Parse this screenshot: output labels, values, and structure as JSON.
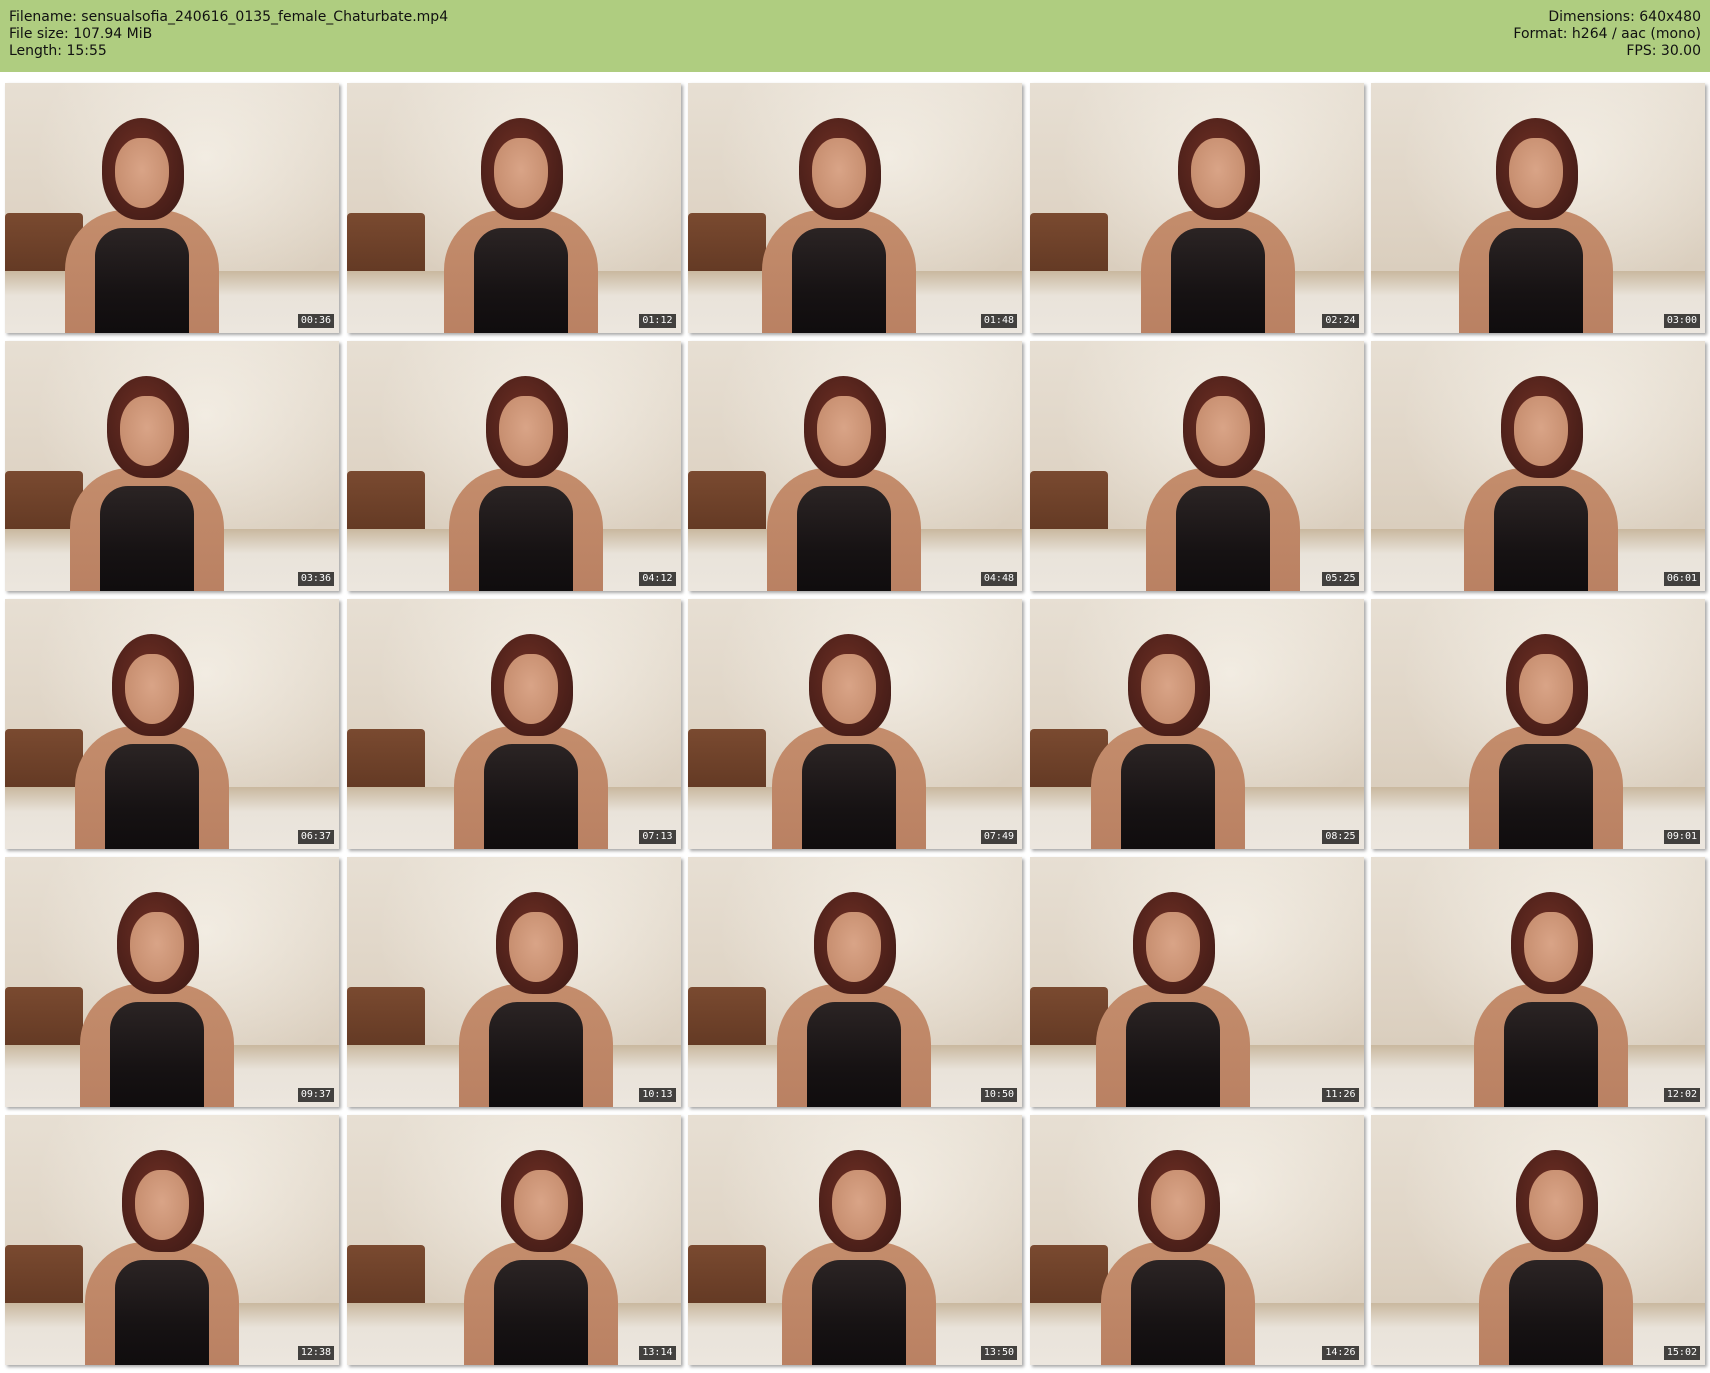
{
  "header": {
    "filename_line": "Filename: sensualsofia_240616_0135_female_Chaturbate.mp4",
    "filesize_line": "File size: 107.94 MiB",
    "length_line": "Length: 15:55",
    "dimensions_line": "Dimensions: 640x480",
    "format_line": "Format: h264 / aac (mono)",
    "fps_line": "FPS: 30.00",
    "background_color": "#afcd80"
  },
  "thumbnails": [
    {
      "timestamp": "00:36"
    },
    {
      "timestamp": "01:12"
    },
    {
      "timestamp": "01:48"
    },
    {
      "timestamp": "02:24"
    },
    {
      "timestamp": "03:00"
    },
    {
      "timestamp": "03:36"
    },
    {
      "timestamp": "04:12"
    },
    {
      "timestamp": "04:48"
    },
    {
      "timestamp": "05:25"
    },
    {
      "timestamp": "06:01"
    },
    {
      "timestamp": "06:37"
    },
    {
      "timestamp": "07:13"
    },
    {
      "timestamp": "07:49"
    },
    {
      "timestamp": "08:25"
    },
    {
      "timestamp": "09:01"
    },
    {
      "timestamp": "09:37"
    },
    {
      "timestamp": "10:13"
    },
    {
      "timestamp": "10:50"
    },
    {
      "timestamp": "11:26"
    },
    {
      "timestamp": "12:02"
    },
    {
      "timestamp": "12:38"
    },
    {
      "timestamp": "13:14"
    },
    {
      "timestamp": "13:50"
    },
    {
      "timestamp": "14:26"
    },
    {
      "timestamp": "15:02"
    }
  ]
}
